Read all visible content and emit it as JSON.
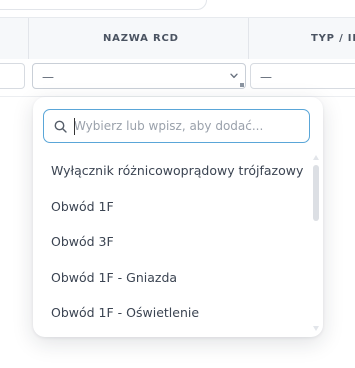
{
  "table": {
    "columns": [
      {
        "label": ""
      },
      {
        "label": "NAZWA RCD"
      },
      {
        "label": "TYP / ID"
      }
    ],
    "filters": [
      {
        "value": ""
      },
      {
        "value": "—"
      },
      {
        "value": "—"
      }
    ]
  },
  "dropdown": {
    "search": {
      "placeholder": "Wybierz lub wpisz, aby dodać...",
      "value": ""
    },
    "options": [
      {
        "label": "Wyłącznik różnicowoprądowy trójfazowy"
      },
      {
        "label": "Obwód 1F"
      },
      {
        "label": "Obwód 3F"
      },
      {
        "label": "Obwód 1F - Gniazda"
      },
      {
        "label": "Obwód 1F - Oświetlenie"
      }
    ]
  },
  "icons": {
    "search": "search-icon",
    "chevron": "chevron-down-icon"
  },
  "colors": {
    "focus_border": "#5aa6d8",
    "header_bg": "#f6f8fa",
    "text_primary": "#3b4452"
  }
}
